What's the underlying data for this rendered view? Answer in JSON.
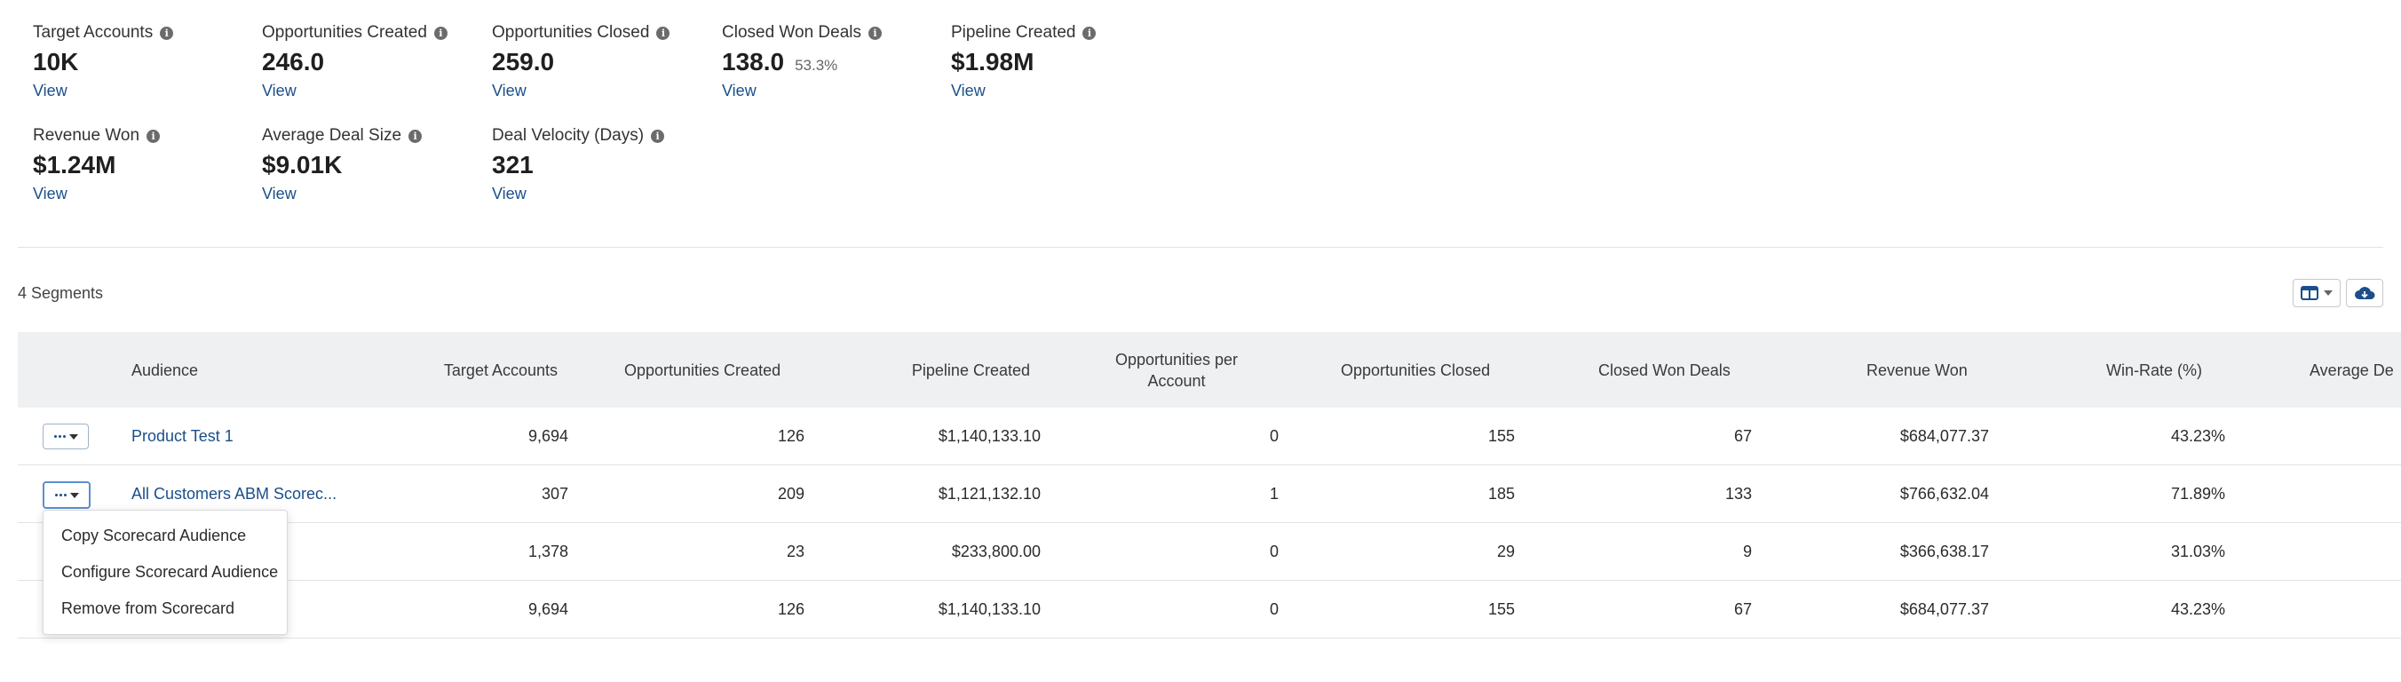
{
  "metrics": [
    {
      "label": "Target Accounts",
      "value": "10K",
      "sub": "",
      "link": "View"
    },
    {
      "label": "Opportunities Created",
      "value": "246.0",
      "sub": "",
      "link": "View"
    },
    {
      "label": "Opportunities Closed",
      "value": "259.0",
      "sub": "",
      "link": "View"
    },
    {
      "label": "Closed Won Deals",
      "value": "138.0",
      "sub": "53.3%",
      "link": "View"
    },
    {
      "label": "Pipeline Created",
      "value": "$1.98M",
      "sub": "",
      "link": "View"
    },
    {
      "label": "Revenue Won",
      "value": "$1.24M",
      "sub": "",
      "link": "View"
    },
    {
      "label": "Average Deal Size",
      "value": "$9.01K",
      "sub": "",
      "link": "View"
    },
    {
      "label": "Deal Velocity (Days)",
      "value": "321",
      "sub": "",
      "link": "View"
    }
  ],
  "info_icon": "info-icon",
  "segments_label": "4 Segments",
  "toolbar": {
    "columns_icon": "columns-icon",
    "download_icon": "cloud-download-icon"
  },
  "table": {
    "headers": {
      "audience": "Audience",
      "target_accounts": "Target Accounts",
      "opps_created": "Opportunities Created",
      "pipeline_created": "Pipeline Created",
      "opps_per_account": "Opportunities per Account",
      "opps_closed": "Opportunities Closed",
      "closed_won": "Closed Won Deals",
      "revenue_won": "Revenue Won",
      "win_rate": "Win-Rate (%)",
      "avg_deal": "Average De"
    },
    "rows": [
      {
        "audience": "Product Test 1",
        "target_accounts": "9,694",
        "opps_created": "126",
        "pipeline_created": "$1,140,133.10",
        "opps_per_account": "0",
        "opps_closed": "155",
        "closed_won": "67",
        "revenue_won": "$684,077.37",
        "win_rate": "43.23%"
      },
      {
        "audience": "All Customers ABM Scorec...",
        "target_accounts": "307",
        "opps_created": "209",
        "pipeline_created": "$1,121,132.10",
        "opps_per_account": "1",
        "opps_closed": "185",
        "closed_won": "133",
        "revenue_won": "$766,632.04",
        "win_rate": "71.89%"
      },
      {
        "audience": "",
        "target_accounts": "1,378",
        "opps_created": "23",
        "pipeline_created": "$233,800.00",
        "opps_per_account": "0",
        "opps_closed": "29",
        "closed_won": "9",
        "revenue_won": "$366,638.17",
        "win_rate": "31.03%"
      },
      {
        "audience": "",
        "target_accounts": "9,694",
        "opps_created": "126",
        "pipeline_created": "$1,140,133.10",
        "opps_per_account": "0",
        "opps_closed": "155",
        "closed_won": "67",
        "revenue_won": "$684,077.37",
        "win_rate": "43.23%"
      }
    ]
  },
  "menu": {
    "items": [
      "Copy Scorecard Audience",
      "Configure Scorecard Audience",
      "Remove from Scorecard"
    ]
  },
  "colors": {
    "link": "#1a4f8b",
    "header_bg": "#eef0f2"
  }
}
